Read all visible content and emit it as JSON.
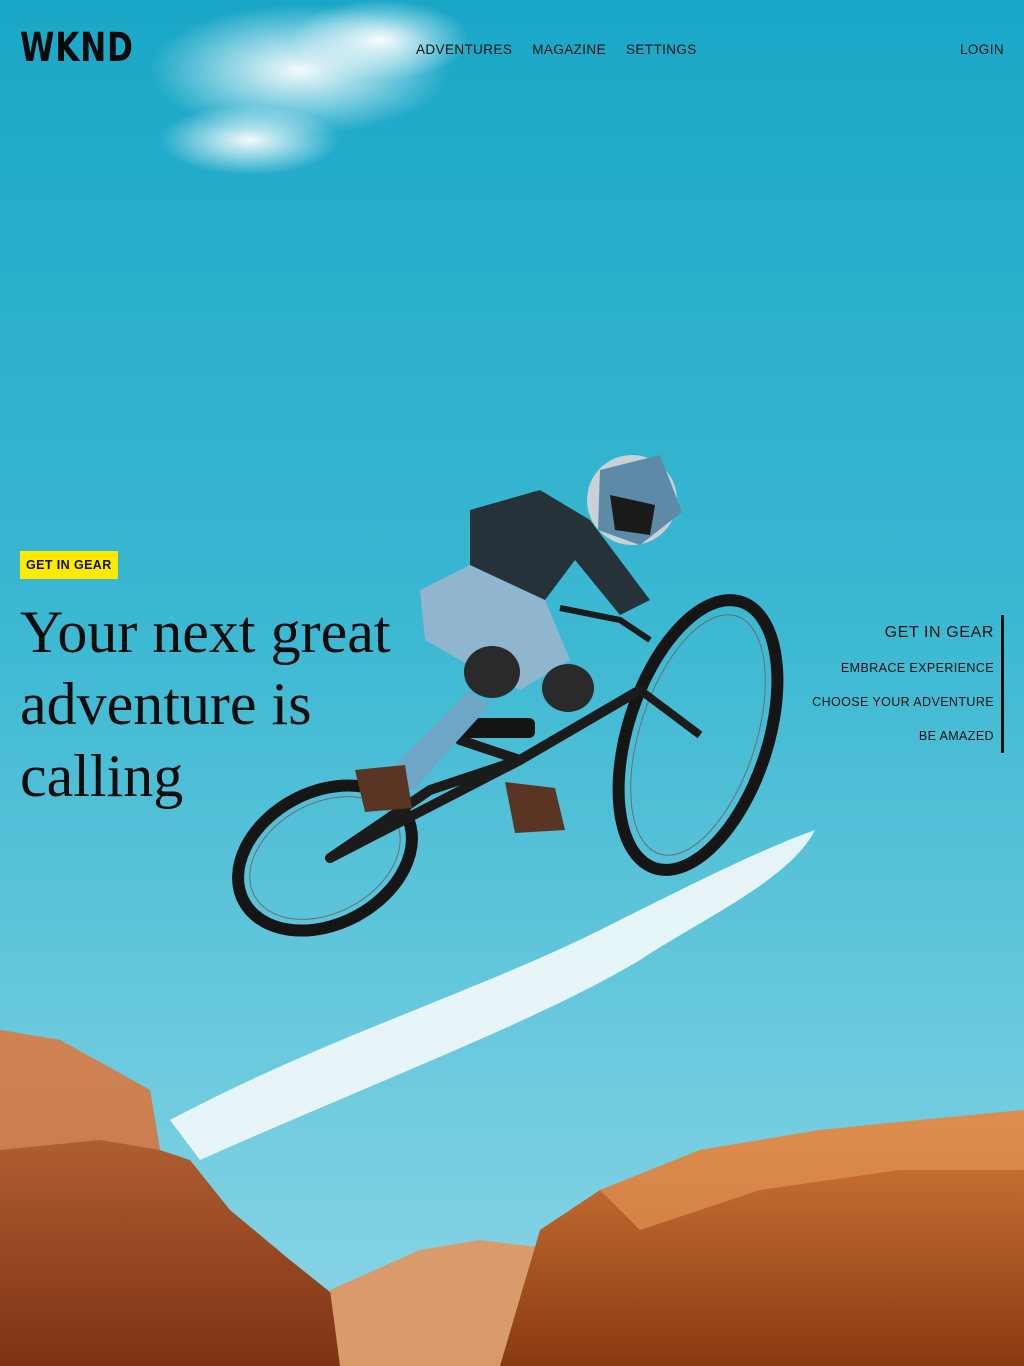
{
  "header": {
    "logo": "WKND",
    "nav": [
      "ADVENTURES",
      "MAGAZINE",
      "SETTINGS"
    ],
    "login": "LOGIN"
  },
  "hero": {
    "eyebrow": "GET IN GEAR",
    "headline": "Your next great adventure is calling",
    "image_alt": "mountain biker jumping over red rock canyon"
  },
  "side_nav": {
    "items": [
      "GET IN GEAR",
      "EMBRACE EXPERIENCE",
      "CHOOSE YOUR ADVENTURE",
      "BE AMAZED"
    ],
    "active_index": 0
  },
  "colors": {
    "accent_yellow": "#ffea00",
    "sky": "#3ab5cc",
    "rock": "#c4622e",
    "text": "#0c0c0c"
  }
}
